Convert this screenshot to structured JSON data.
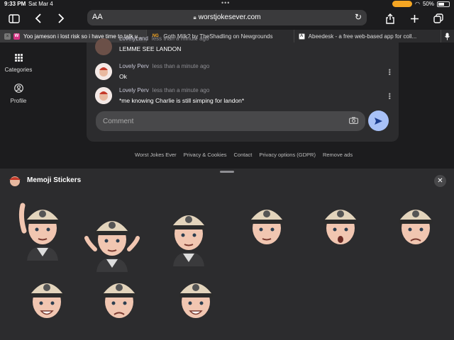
{
  "status": {
    "time": "9:33 PM",
    "date": "Sat Mar 4",
    "battery": "50%"
  },
  "toolbar": {
    "text_size": "AA",
    "url": "worstjokesever.com"
  },
  "tabs": [
    {
      "title": "Yoo jameson i lost risk so i have time to talk u...",
      "favicon": "W",
      "favicon_color": "#d63384",
      "active": true
    },
    {
      "title": "Goth Milk? by TheShadling on Newgrounds",
      "favicon": "NG",
      "favicon_color": "#f5a623",
      "active": false
    },
    {
      "title": "Abeedesk - a free web-based app for coll...",
      "favicon": "A",
      "favicon_color": "#444444",
      "active": false
    }
  ],
  "sidebar": [
    {
      "label": "Categories",
      "icon": "grid-icon"
    },
    {
      "label": "Profile",
      "icon": "user-circle-icon"
    }
  ],
  "comments": [
    {
      "name": "LovelyLand",
      "time": "less than a minute ago",
      "text": "LEMME SEE LANDON"
    },
    {
      "name": "Lovely Perv",
      "time": "less than a minute ago",
      "text": "Ok"
    },
    {
      "name": "Lovely Perv",
      "time": "less than a minute ago",
      "text": "*me knowing Charlie is still simping for landon*"
    }
  ],
  "comment_input": {
    "placeholder": "Comment"
  },
  "footer": [
    "Worst Jokes Ever",
    "Privacy & Cookies",
    "Contact",
    "Privacy options (GDPR)",
    "Remove ads"
  ],
  "panel": {
    "title": "Memoji Stickers"
  },
  "stickers": [
    {
      "name": "waving"
    },
    {
      "name": "shrugging"
    },
    {
      "name": "facepalm"
    },
    {
      "name": "neutral"
    },
    {
      "name": "surprised"
    },
    {
      "name": "frowning"
    },
    {
      "name": "winking"
    },
    {
      "name": "sad"
    },
    {
      "name": "smiling"
    }
  ],
  "colors": {
    "background": "#1c1c1e",
    "card": "#2c2c2e",
    "accent": "#a8c1f7",
    "battery_pill": "#f5a623"
  }
}
